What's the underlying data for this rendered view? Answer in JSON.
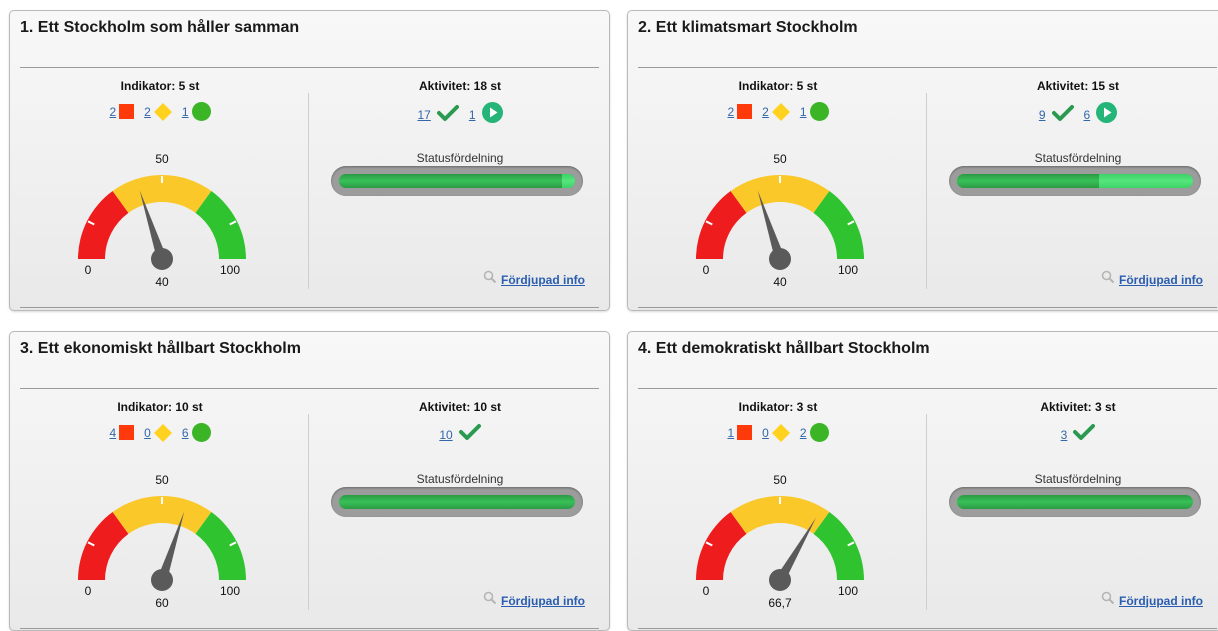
{
  "panels": [
    {
      "title": "1. Ett Stockholm som håller samman",
      "indicator_label": "Indikator: 5 st",
      "indicators": {
        "red": "2",
        "yellow": "2",
        "green": "1"
      },
      "activity_label": "Aktivitet: 18 st",
      "activities": [
        {
          "count": "17",
          "icon": "check-icon"
        },
        {
          "count": "1",
          "icon": "play-icon"
        }
      ],
      "status_label": "Statusfördelning",
      "status_fractions": {
        "done": 0.944,
        "running": 0.056
      },
      "gauge": {
        "min_label": "0",
        "mid_label": "50",
        "max_label": "100",
        "value": 40,
        "value_label": "40"
      },
      "more_label": "Fördjupad info"
    },
    {
      "title": "2. Ett klimatsmart Stockholm",
      "indicator_label": "Indikator: 5 st",
      "indicators": {
        "red": "2",
        "yellow": "2",
        "green": "1"
      },
      "activity_label": "Aktivitet: 15 st",
      "activities": [
        {
          "count": "9",
          "icon": "check-icon"
        },
        {
          "count": "6",
          "icon": "play-icon"
        }
      ],
      "status_label": "Statusfördelning",
      "status_fractions": {
        "done": 0.6,
        "running": 0.4
      },
      "gauge": {
        "min_label": "0",
        "mid_label": "50",
        "max_label": "100",
        "value": 40,
        "value_label": "40"
      },
      "more_label": "Fördjupad info"
    },
    {
      "title": "3. Ett ekonomiskt hållbart Stockholm",
      "indicator_label": "Indikator: 10 st",
      "indicators": {
        "red": "4",
        "yellow": "0",
        "green": "6"
      },
      "activity_label": "Aktivitet: 10 st",
      "activities": [
        {
          "count": "10",
          "icon": "check-icon"
        }
      ],
      "status_label": "Statusfördelning",
      "status_fractions": {
        "done": 1.0,
        "running": 0
      },
      "gauge": {
        "min_label": "0",
        "mid_label": "50",
        "max_label": "100",
        "value": 60,
        "value_label": "60"
      },
      "more_label": "Fördjupad info"
    },
    {
      "title": "4. Ett demokratiskt hållbart Stockholm",
      "indicator_label": "Indikator: 3 st",
      "indicators": {
        "red": "1",
        "yellow": "0",
        "green": "2"
      },
      "activity_label": "Aktivitet: 3 st",
      "activities": [
        {
          "count": "3",
          "icon": "check-icon"
        }
      ],
      "status_label": "Statusfördelning",
      "status_fractions": {
        "done": 1.0,
        "running": 0
      },
      "gauge": {
        "min_label": "0",
        "mid_label": "50",
        "max_label": "100",
        "value": 66.7,
        "value_label": "66,7"
      },
      "more_label": "Fördjupad info"
    }
  ],
  "colors": {
    "red_status": "#ff3a0a",
    "yellow_status": "#ffd21f",
    "green_status": "#3bb526",
    "gauge_red": "#ee1c1c",
    "gauge_yellow": "#fbc82a",
    "gauge_green": "#2fc42f",
    "check": "#2a9a50",
    "play": "#26b578",
    "link": "#2a5db0"
  }
}
